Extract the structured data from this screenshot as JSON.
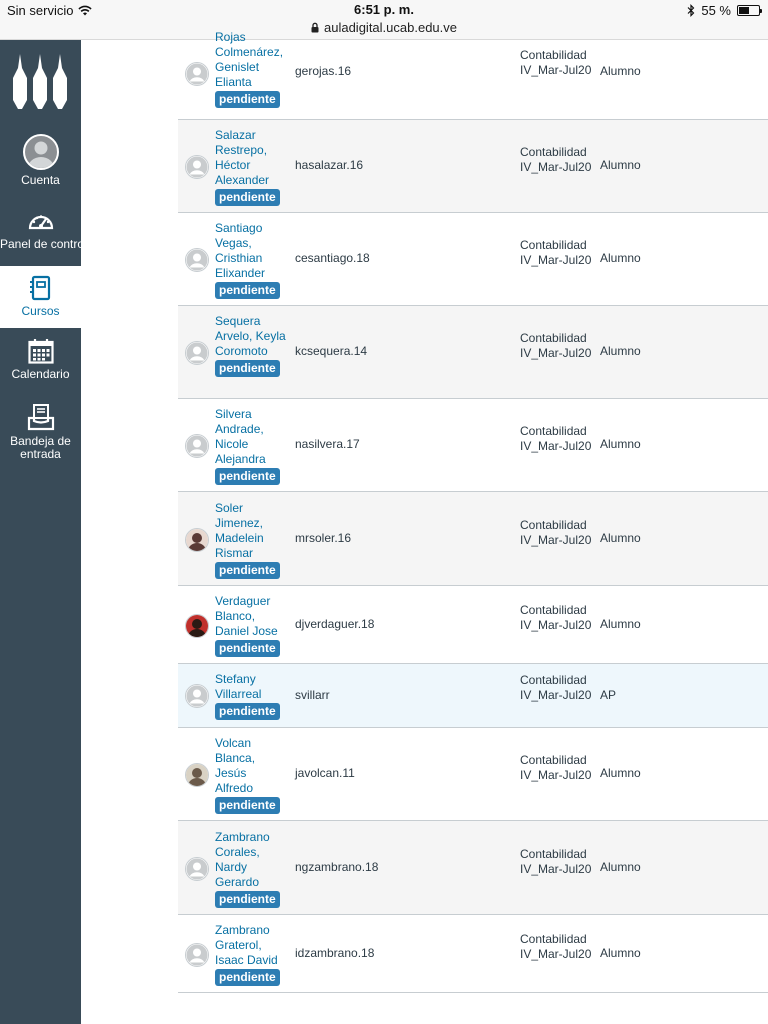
{
  "status_bar": {
    "carrier": "Sin servicio",
    "time": "6:51 p. m.",
    "url": "auladigital.ucab.edu.ve",
    "battery": "55 %",
    "battery_level": 0.55
  },
  "sidebar": {
    "items": [
      {
        "label": "Cuenta",
        "icon": "account-avatar-icon"
      },
      {
        "label": "Panel de control",
        "icon": "dashboard-icon"
      },
      {
        "label": "Cursos",
        "icon": "courses-icon",
        "active": true
      },
      {
        "label": "Calendario",
        "icon": "calendar-icon"
      },
      {
        "label": "Bandeja de entrada",
        "icon": "inbox-icon"
      }
    ],
    "colors": {
      "background": "#394b58",
      "active_text": "#0770a3"
    }
  },
  "roster": {
    "badge_label": "pendiente",
    "rows": [
      {
        "name": "Rojas Colmenárez, Genislet Elianta",
        "login": "gerojas.16",
        "section": "Contabilidad IV_Mar-Jul20",
        "role": "Alumno",
        "avatar": "default"
      },
      {
        "name": "Salazar Restrepo, Héctor Alexander",
        "login": "hasalazar.16",
        "section": "Contabilidad IV_Mar-Jul20",
        "role": "Alumno",
        "avatar": "default"
      },
      {
        "name": "Santiago Vegas, Cristhian Elixander",
        "login": "cesantiago.18",
        "section": "Contabilidad IV_Mar-Jul20",
        "role": "Alumno",
        "avatar": "default"
      },
      {
        "name": "Sequera Arvelo, Keyla Coromoto",
        "login": "kcsequera.14",
        "section": "Contabilidad IV_Mar-Jul20",
        "role": "Alumno",
        "avatar": "default"
      },
      {
        "name": "Silvera Andrade, Nicole Alejandra",
        "login": "nasilvera.17",
        "section": "Contabilidad IV_Mar-Jul20",
        "role": "Alumno",
        "avatar": "default"
      },
      {
        "name": "Soler Jimenez, Madelein Rismar",
        "login": "mrsoler.16",
        "section": "Contabilidad IV_Mar-Jul20",
        "role": "Alumno",
        "avatar": "photo"
      },
      {
        "name": "Verdaguer Blanco, Daniel Jose",
        "login": "djverdaguer.18",
        "section": "Contabilidad IV_Mar-Jul20",
        "role": "Alumno",
        "avatar": "photo"
      },
      {
        "name": "Stefany Villarreal",
        "login": "svillarr",
        "section": "Contabilidad IV_Mar-Jul20",
        "role": "AP",
        "avatar": "default"
      },
      {
        "name": "Volcan Blanca, Jesús Alfredo",
        "login": "javolcan.11",
        "section": "Contabilidad IV_Mar-Jul20",
        "role": "Alumno",
        "avatar": "photo"
      },
      {
        "name": "Zambrano Corales, Nardy Gerardo",
        "login": "ngzambrano.18",
        "section": "Contabilidad IV_Mar-Jul20",
        "role": "Alumno",
        "avatar": "default"
      },
      {
        "name": "Zambrano Graterol, Isaac David",
        "login": "idzambrano.18",
        "section": "Contabilidad IV_Mar-Jul20",
        "role": "Alumno",
        "avatar": "default"
      }
    ]
  }
}
